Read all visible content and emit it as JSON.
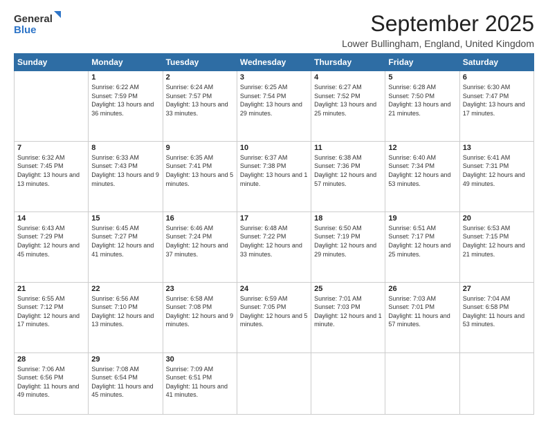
{
  "header": {
    "logo_line1": "General",
    "logo_line2": "Blue",
    "month": "September 2025",
    "location": "Lower Bullingham, England, United Kingdom"
  },
  "weekdays": [
    "Sunday",
    "Monday",
    "Tuesday",
    "Wednesday",
    "Thursday",
    "Friday",
    "Saturday"
  ],
  "weeks": [
    [
      {
        "day": "",
        "sunrise": "",
        "sunset": "",
        "daylight": ""
      },
      {
        "day": "1",
        "sunrise": "Sunrise: 6:22 AM",
        "sunset": "Sunset: 7:59 PM",
        "daylight": "Daylight: 13 hours and 36 minutes."
      },
      {
        "day": "2",
        "sunrise": "Sunrise: 6:24 AM",
        "sunset": "Sunset: 7:57 PM",
        "daylight": "Daylight: 13 hours and 33 minutes."
      },
      {
        "day": "3",
        "sunrise": "Sunrise: 6:25 AM",
        "sunset": "Sunset: 7:54 PM",
        "daylight": "Daylight: 13 hours and 29 minutes."
      },
      {
        "day": "4",
        "sunrise": "Sunrise: 6:27 AM",
        "sunset": "Sunset: 7:52 PM",
        "daylight": "Daylight: 13 hours and 25 minutes."
      },
      {
        "day": "5",
        "sunrise": "Sunrise: 6:28 AM",
        "sunset": "Sunset: 7:50 PM",
        "daylight": "Daylight: 13 hours and 21 minutes."
      },
      {
        "day": "6",
        "sunrise": "Sunrise: 6:30 AM",
        "sunset": "Sunset: 7:47 PM",
        "daylight": "Daylight: 13 hours and 17 minutes."
      }
    ],
    [
      {
        "day": "7",
        "sunrise": "Sunrise: 6:32 AM",
        "sunset": "Sunset: 7:45 PM",
        "daylight": "Daylight: 13 hours and 13 minutes."
      },
      {
        "day": "8",
        "sunrise": "Sunrise: 6:33 AM",
        "sunset": "Sunset: 7:43 PM",
        "daylight": "Daylight: 13 hours and 9 minutes."
      },
      {
        "day": "9",
        "sunrise": "Sunrise: 6:35 AM",
        "sunset": "Sunset: 7:41 PM",
        "daylight": "Daylight: 13 hours and 5 minutes."
      },
      {
        "day": "10",
        "sunrise": "Sunrise: 6:37 AM",
        "sunset": "Sunset: 7:38 PM",
        "daylight": "Daylight: 13 hours and 1 minute."
      },
      {
        "day": "11",
        "sunrise": "Sunrise: 6:38 AM",
        "sunset": "Sunset: 7:36 PM",
        "daylight": "Daylight: 12 hours and 57 minutes."
      },
      {
        "day": "12",
        "sunrise": "Sunrise: 6:40 AM",
        "sunset": "Sunset: 7:34 PM",
        "daylight": "Daylight: 12 hours and 53 minutes."
      },
      {
        "day": "13",
        "sunrise": "Sunrise: 6:41 AM",
        "sunset": "Sunset: 7:31 PM",
        "daylight": "Daylight: 12 hours and 49 minutes."
      }
    ],
    [
      {
        "day": "14",
        "sunrise": "Sunrise: 6:43 AM",
        "sunset": "Sunset: 7:29 PM",
        "daylight": "Daylight: 12 hours and 45 minutes."
      },
      {
        "day": "15",
        "sunrise": "Sunrise: 6:45 AM",
        "sunset": "Sunset: 7:27 PM",
        "daylight": "Daylight: 12 hours and 41 minutes."
      },
      {
        "day": "16",
        "sunrise": "Sunrise: 6:46 AM",
        "sunset": "Sunset: 7:24 PM",
        "daylight": "Daylight: 12 hours and 37 minutes."
      },
      {
        "day": "17",
        "sunrise": "Sunrise: 6:48 AM",
        "sunset": "Sunset: 7:22 PM",
        "daylight": "Daylight: 12 hours and 33 minutes."
      },
      {
        "day": "18",
        "sunrise": "Sunrise: 6:50 AM",
        "sunset": "Sunset: 7:19 PM",
        "daylight": "Daylight: 12 hours and 29 minutes."
      },
      {
        "day": "19",
        "sunrise": "Sunrise: 6:51 AM",
        "sunset": "Sunset: 7:17 PM",
        "daylight": "Daylight: 12 hours and 25 minutes."
      },
      {
        "day": "20",
        "sunrise": "Sunrise: 6:53 AM",
        "sunset": "Sunset: 7:15 PM",
        "daylight": "Daylight: 12 hours and 21 minutes."
      }
    ],
    [
      {
        "day": "21",
        "sunrise": "Sunrise: 6:55 AM",
        "sunset": "Sunset: 7:12 PM",
        "daylight": "Daylight: 12 hours and 17 minutes."
      },
      {
        "day": "22",
        "sunrise": "Sunrise: 6:56 AM",
        "sunset": "Sunset: 7:10 PM",
        "daylight": "Daylight: 12 hours and 13 minutes."
      },
      {
        "day": "23",
        "sunrise": "Sunrise: 6:58 AM",
        "sunset": "Sunset: 7:08 PM",
        "daylight": "Daylight: 12 hours and 9 minutes."
      },
      {
        "day": "24",
        "sunrise": "Sunrise: 6:59 AM",
        "sunset": "Sunset: 7:05 PM",
        "daylight": "Daylight: 12 hours and 5 minutes."
      },
      {
        "day": "25",
        "sunrise": "Sunrise: 7:01 AM",
        "sunset": "Sunset: 7:03 PM",
        "daylight": "Daylight: 12 hours and 1 minute."
      },
      {
        "day": "26",
        "sunrise": "Sunrise: 7:03 AM",
        "sunset": "Sunset: 7:01 PM",
        "daylight": "Daylight: 11 hours and 57 minutes."
      },
      {
        "day": "27",
        "sunrise": "Sunrise: 7:04 AM",
        "sunset": "Sunset: 6:58 PM",
        "daylight": "Daylight: 11 hours and 53 minutes."
      }
    ],
    [
      {
        "day": "28",
        "sunrise": "Sunrise: 7:06 AM",
        "sunset": "Sunset: 6:56 PM",
        "daylight": "Daylight: 11 hours and 49 minutes."
      },
      {
        "day": "29",
        "sunrise": "Sunrise: 7:08 AM",
        "sunset": "Sunset: 6:54 PM",
        "daylight": "Daylight: 11 hours and 45 minutes."
      },
      {
        "day": "30",
        "sunrise": "Sunrise: 7:09 AM",
        "sunset": "Sunset: 6:51 PM",
        "daylight": "Daylight: 11 hours and 41 minutes."
      },
      {
        "day": "",
        "sunrise": "",
        "sunset": "",
        "daylight": ""
      },
      {
        "day": "",
        "sunrise": "",
        "sunset": "",
        "daylight": ""
      },
      {
        "day": "",
        "sunrise": "",
        "sunset": "",
        "daylight": ""
      },
      {
        "day": "",
        "sunrise": "",
        "sunset": "",
        "daylight": ""
      }
    ]
  ]
}
